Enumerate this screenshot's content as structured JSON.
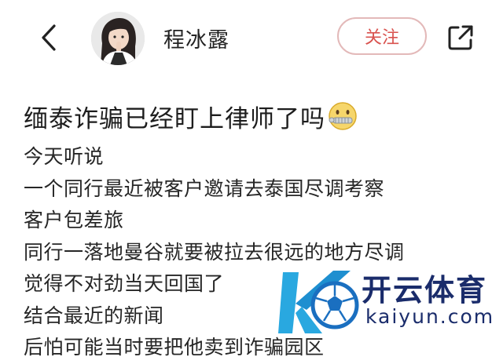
{
  "header": {
    "author_name": "程冰露",
    "follow_label": "关注",
    "icons": {
      "back": "chevron-left-icon",
      "share": "share-external-icon"
    }
  },
  "post": {
    "title": "缅泰诈骗已经盯上律师了吗",
    "title_emoji": "zipper-mouth-face",
    "lines": [
      "今天听说",
      "一个同行最近被客户邀请去泰国尽调考察",
      "客户包差旅",
      "同行一落地曼谷就要被拉去很远的地方尽调",
      "觉得不对劲当天回国了",
      "结合最近的新闻",
      "后怕可能当时要把他卖到诈骗园区"
    ]
  },
  "watermark": {
    "brand": "开云体育",
    "url": "kaiyun.com"
  },
  "colors": {
    "follow_text": "#d9534f",
    "follow_border": "#e3b9b9",
    "watermark_blue": "#1a2c6b",
    "watermark_cyan": "#29a8e0"
  }
}
